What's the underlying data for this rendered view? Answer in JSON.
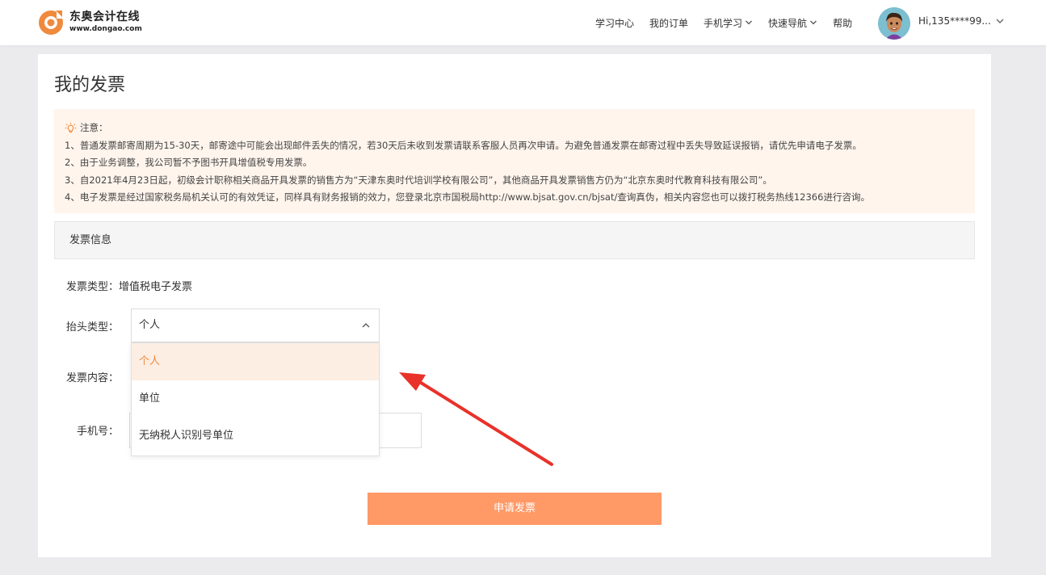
{
  "header": {
    "logo_cn": "东奥会计在线",
    "logo_url": "www.dongao.com",
    "nav": [
      {
        "label": "学习中心",
        "dropdown": false
      },
      {
        "label": "我的订单",
        "dropdown": false
      },
      {
        "label": "手机学习",
        "dropdown": true
      },
      {
        "label": "快速导航",
        "dropdown": true
      },
      {
        "label": "帮助",
        "dropdown": false
      }
    ],
    "user_label": "Hi,135****99..."
  },
  "page": {
    "title": "我的发票",
    "notice": {
      "heading": "注意：",
      "lines": [
        "1、普通发票邮寄周期为15-30天，邮寄途中可能会出现邮件丢失的情况，若30天后未收到发票请联系客服人员再次申请。为避免普通发票在邮寄过程中丢失导致延误报销，请优先申请电子发票。",
        "2、由于业务调整，我公司暂不予图书开具增值税专用发票。",
        "3、自2021年4月23日起，初级会计职称相关商品开具发票的销售方为“天津东奥时代培训学校有限公司”，其他商品开具发票销售方仍为“北京东奥时代教育科技有限公司”。",
        "4、电子发票是经过国家税务局机关认可的有效凭证，同样具有财务报销的效力，您登录北京市国税局http://www.bjsat.gov.cn/bjsat/查询真伪，相关内容您也可以拨打税务热线12366进行咨询。"
      ]
    },
    "section_title": "发票信息",
    "form": {
      "invoice_type_label": "发票类型：",
      "invoice_type_value": "增值税电子发票",
      "title_type_label": "抬头类型：",
      "title_type_selected": "个人",
      "title_type_options": [
        "个人",
        "单位",
        "无纳税人识别号单位"
      ],
      "content_label": "发票内容：",
      "phone_label": "手机号：",
      "phone_value": ""
    },
    "submit_label": "申请发票"
  },
  "colors": {
    "accent": "#ff9966",
    "selected_text": "#f08a3c",
    "annotation_arrow": "#e8322a"
  }
}
